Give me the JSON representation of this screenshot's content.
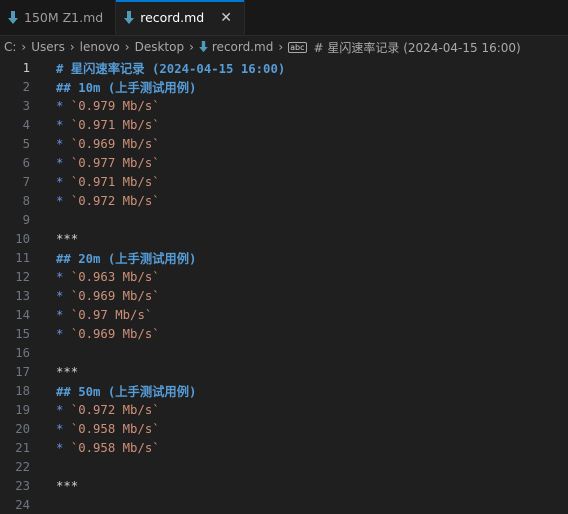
{
  "tabs": [
    {
      "label": "150M Z1.md",
      "active": false,
      "icon": "markdown-icon"
    },
    {
      "label": "record.md",
      "active": true,
      "icon": "markdown-icon"
    }
  ],
  "breadcrumb": {
    "parts": [
      "C:",
      "Users",
      "lenovo",
      "Desktop",
      "record.md"
    ],
    "symbol": "# 星闪速率记录 (2024-04-15 16:00)",
    "symbol_icon_text": "abc"
  },
  "lines": [
    {
      "num": "1",
      "type": "h",
      "text": "# 星闪速率记录 (2024-04-15 16:00)"
    },
    {
      "num": "2",
      "type": "h",
      "text": "## 10m (上手测试用例)"
    },
    {
      "num": "3",
      "type": "v",
      "bullet": "* ",
      "text": "`0.979 Mb/s`"
    },
    {
      "num": "4",
      "type": "v",
      "bullet": "* ",
      "text": "`0.971 Mb/s`"
    },
    {
      "num": "5",
      "type": "v",
      "bullet": "* ",
      "text": "`0.969 Mb/s`"
    },
    {
      "num": "6",
      "type": "v",
      "bullet": "* ",
      "text": "`0.977 Mb/s`"
    },
    {
      "num": "7",
      "type": "v",
      "bullet": "* ",
      "text": "`0.971 Mb/s`"
    },
    {
      "num": "8",
      "type": "v",
      "bullet": "* ",
      "text": "`0.972 Mb/s`"
    },
    {
      "num": "9",
      "type": "e",
      "text": ""
    },
    {
      "num": "10",
      "type": "r",
      "text": "***"
    },
    {
      "num": "11",
      "type": "h",
      "text": "## 20m (上手测试用例)"
    },
    {
      "num": "12",
      "type": "v",
      "bullet": "* ",
      "text": "`0.963 Mb/s`"
    },
    {
      "num": "13",
      "type": "v",
      "bullet": "* ",
      "text": "`0.969 Mb/s`"
    },
    {
      "num": "14",
      "type": "v",
      "bullet": "* ",
      "text": "`0.97 Mb/s`"
    },
    {
      "num": "15",
      "type": "v",
      "bullet": "* ",
      "text": "`0.969 Mb/s`"
    },
    {
      "num": "16",
      "type": "e",
      "text": ""
    },
    {
      "num": "17",
      "type": "r",
      "text": "***"
    },
    {
      "num": "18",
      "type": "h",
      "text": "## 50m (上手测试用例)"
    },
    {
      "num": "19",
      "type": "v",
      "bullet": "* ",
      "text": "`0.972 Mb/s`"
    },
    {
      "num": "20",
      "type": "v",
      "bullet": "* ",
      "text": "`0.958 Mb/s`"
    },
    {
      "num": "21",
      "type": "v",
      "bullet": "* ",
      "text": "`0.958 Mb/s`"
    },
    {
      "num": "22",
      "type": "e",
      "text": ""
    },
    {
      "num": "23",
      "type": "r",
      "text": "***"
    },
    {
      "num": "24",
      "type": "e",
      "text": ""
    }
  ],
  "current_line": "1",
  "colors": {
    "heading": "#569cd6",
    "bullet": "#6796e6",
    "value": "#ce9178",
    "accent": "#0078d4"
  }
}
